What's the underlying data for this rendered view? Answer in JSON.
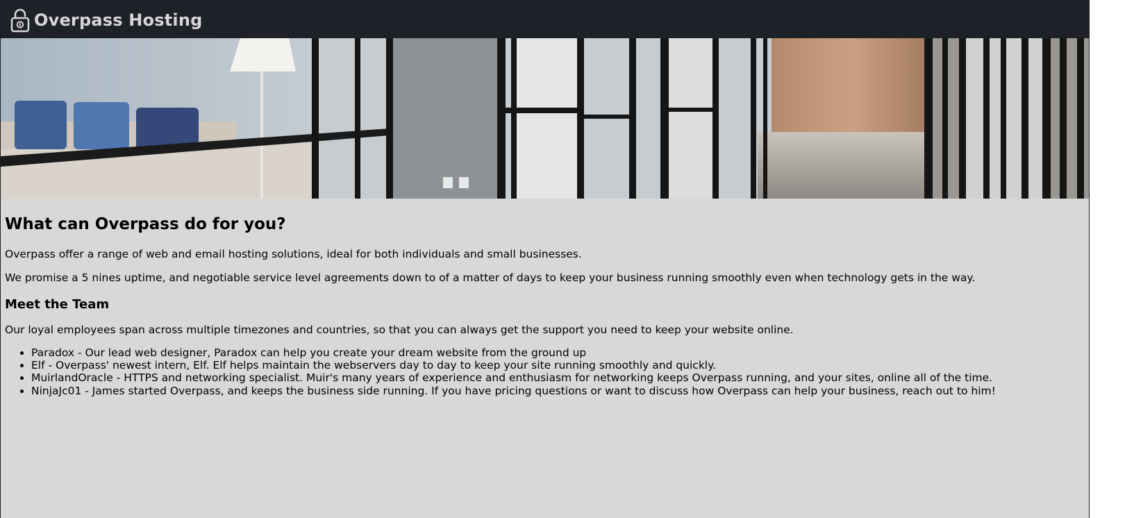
{
  "header": {
    "site_title": "Overpass Hosting",
    "logo_icon": "padlock-icon",
    "background_color": "#1e2128"
  },
  "hero": {
    "image": "office-corridor-banner"
  },
  "main": {
    "heading": "What can Overpass do for you?",
    "intro_paragraph": "Overpass offer a range of web and email hosting solutions, ideal for both individuals and small businesses.",
    "uptime_paragraph": "We promise a 5 nines uptime, and negotiable service level agreements down to of a matter of days to keep your business running smoothly even when technology gets in the way.",
    "team_heading": "Meet the Team",
    "team_intro": "Our loyal employees span across multiple timezones and countries, so that you can always get the support you need to keep your website online.",
    "team_members": [
      "Paradox - Our lead web designer, Paradox can help you create your dream website from the ground up",
      "Elf - Overpass' newest intern, Elf. Elf helps maintain the webservers day to day to keep your site running smoothly and quickly.",
      "MuirlandOracle - HTTPS and networking specialist. Muir's many years of experience and enthusiasm for networking keeps Overpass running, and your sites, online all of the time.",
      "NinjaJc01 - James started Overpass, and keeps the business side running. If you have pricing questions or want to discuss how Overpass can help your business, reach out to him!"
    ]
  },
  "colors": {
    "page_background": "#d8d8d8",
    "header_text": "#d6d6d6"
  }
}
